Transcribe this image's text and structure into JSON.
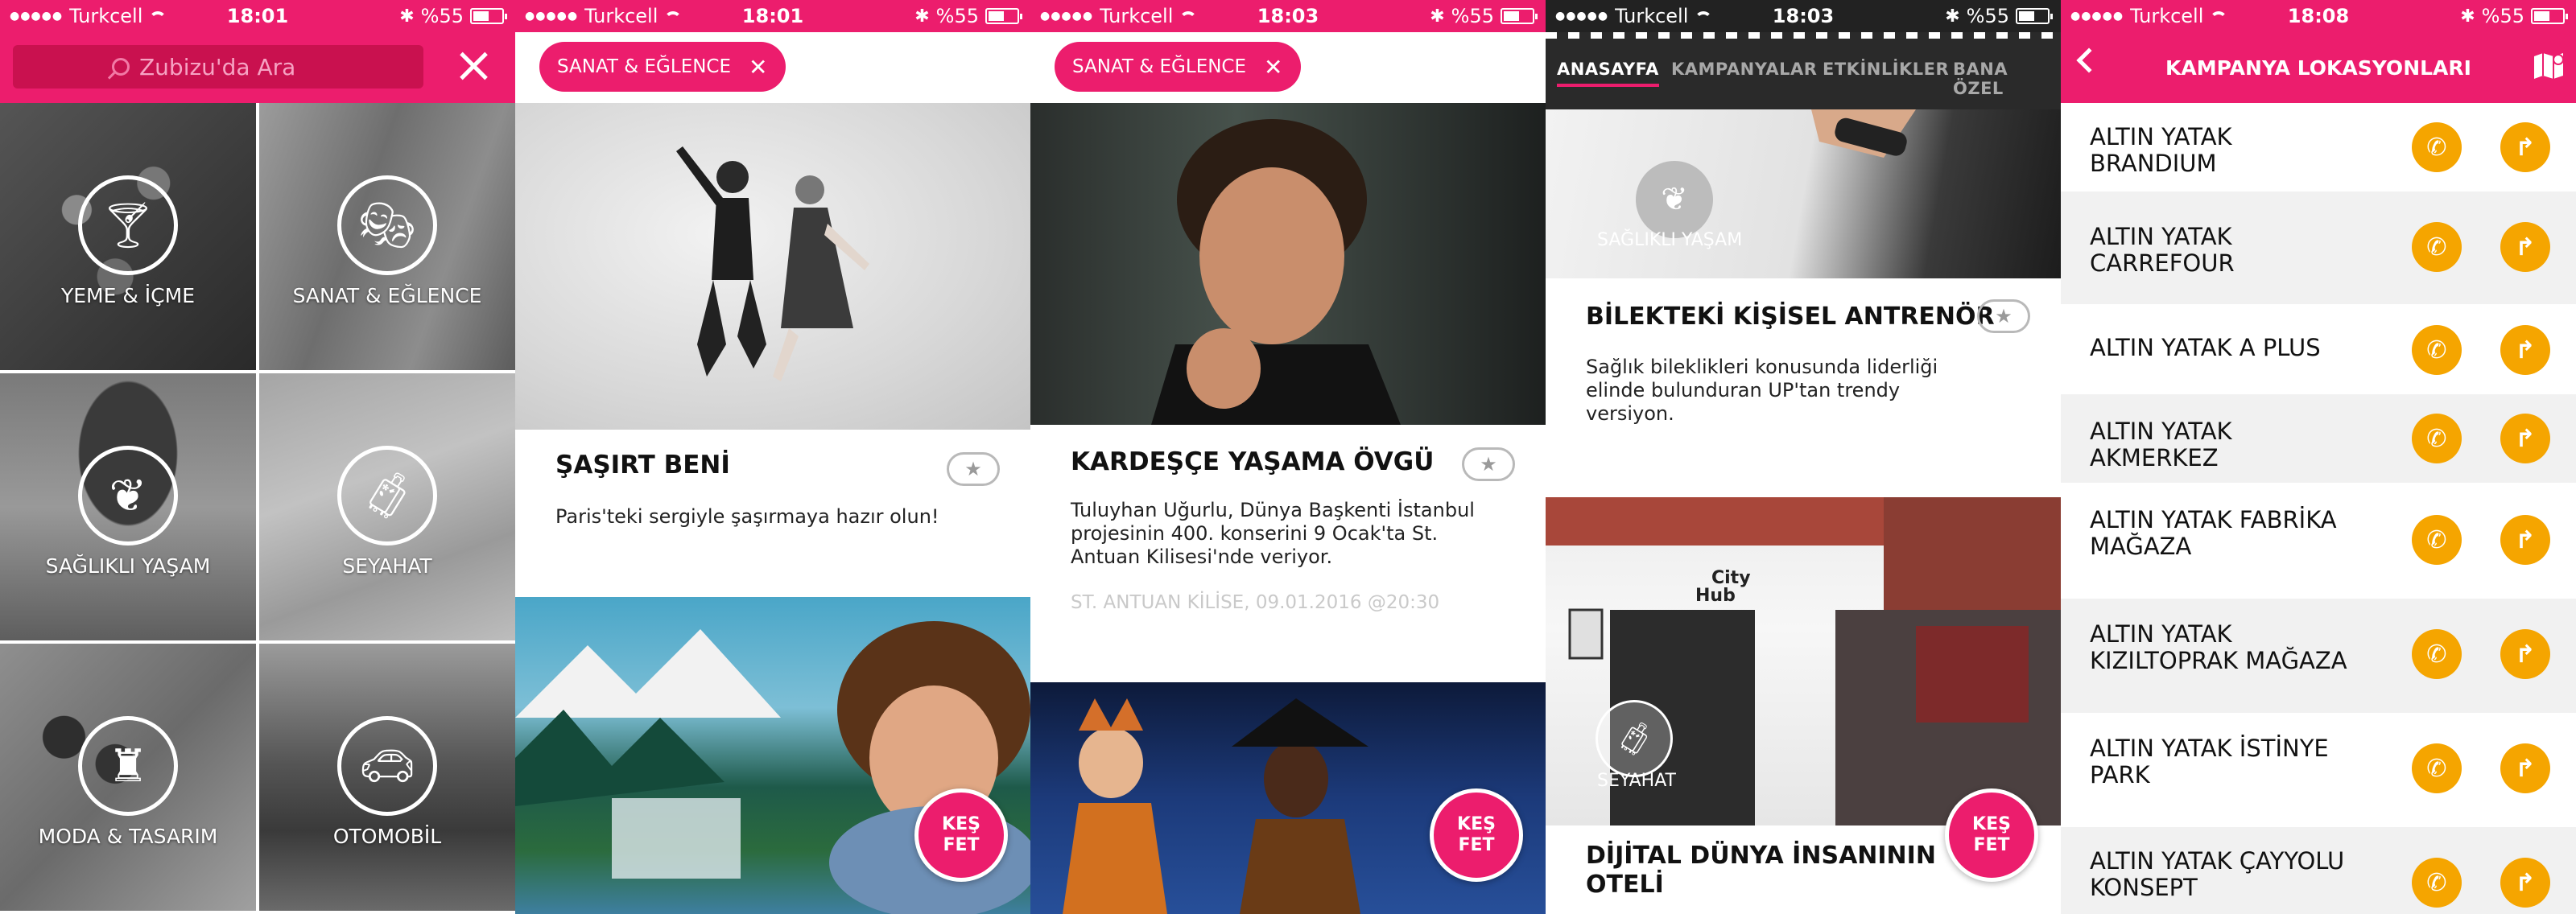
{
  "status_bars": [
    {
      "carrier": "Turkcell",
      "time": "18:01",
      "battery": "%55"
    },
    {
      "carrier": "Turkcell",
      "time": "18:01",
      "battery": "%55"
    },
    {
      "carrier": "Turkcell",
      "time": "18:03",
      "battery": "%55"
    },
    {
      "carrier": "Turkcell",
      "time": "18:03",
      "battery": "%55"
    },
    {
      "carrier": "Turkcell",
      "time": "18:08",
      "battery": "%55"
    }
  ],
  "battery_level": 0.55,
  "colors": {
    "brand": "#ec1d6d",
    "accent_orange": "#f5a500",
    "dark_tabbar": "#2a2a2a"
  },
  "screen1": {
    "search_placeholder": "Zubizu'da Ara",
    "categories": [
      {
        "label": "YEME & İÇME",
        "icon": "cocktail-icon"
      },
      {
        "label": "SANAT & EĞLENCE",
        "icon": "theater-masks-icon"
      },
      {
        "label": "SAĞLIKLI YAŞAM",
        "icon": "leaf-icon"
      },
      {
        "label": "SEYAHAT",
        "icon": "luggage-icon"
      },
      {
        "label": "MODA & TASARIM",
        "icon": "dress-form-icon"
      },
      {
        "label": "OTOMOBİL",
        "icon": "car-icon"
      }
    ]
  },
  "screen2": {
    "filter_chip": "SANAT & EĞLENCE",
    "card1": {
      "title": "ŞAŞIRT BENİ",
      "description": "Paris'teki sergiyle şaşırmaya hazır olun!"
    },
    "discover": {
      "line1": "KEŞ",
      "line2": "FET"
    }
  },
  "screen3": {
    "filter_chip": "SANAT & EĞLENCE",
    "card1": {
      "title": "KARDEŞÇE YAŞAMA ÖVGÜ",
      "description": "Tuluyhan Uğurlu, Dünya Başkenti İstanbul projesinin 400. konserini 9 Ocak'ta St. Antuan Kilisesi'nde veriyor.",
      "meta": "ST. ANTUAN KİLİSE, 09.01.2016 @20:30"
    },
    "discover": {
      "line1": "KEŞ",
      "line2": "FET"
    }
  },
  "screen4": {
    "tabs": [
      "ANASAYFA",
      "KAMPANYALAR",
      "ETKİNLİKLER",
      "BANA ÖZEL"
    ],
    "card1": {
      "category": "SAĞLIKLI YAŞAM",
      "title": "BİLEKTEKİ KİŞİSEL ANTRENÖR",
      "description": "Sağlık bileklikleri konusunda liderliği elinde bulunduran UP'tan trendy versiyon."
    },
    "card2": {
      "category": "SEYAHAT",
      "sign_line1": "City",
      "sign_line2": "Hub",
      "title_line1": "DİJİTAL DÜNYA İNSANININ",
      "title_line2": "OTELİ"
    },
    "discover": {
      "line1": "KEŞ",
      "line2": "FET"
    }
  },
  "screen5": {
    "title": "KAMPANYA LOKASYONLARI",
    "locations": [
      {
        "line1": "ALTIN YATAK BRANDIUM",
        "line2": ""
      },
      {
        "line1": "ALTIN YATAK",
        "line2": "CARREFOUR"
      },
      {
        "line1": "ALTIN YATAK A PLUS",
        "line2": ""
      },
      {
        "line1": "ALTIN YATAK AKMERKEZ",
        "line2": ""
      },
      {
        "line1": "ALTIN YATAK FABRİKA",
        "line2": "MAĞAZA"
      },
      {
        "line1": "ALTIN YATAK",
        "line2": "KIZILTOPRAK MAĞAZA"
      },
      {
        "line1": "ALTIN YATAK İSTİNYE",
        "line2": "PARK"
      },
      {
        "line1": "ALTIN YATAK ÇAYYOLU",
        "line2": "KONSEPT"
      }
    ]
  }
}
